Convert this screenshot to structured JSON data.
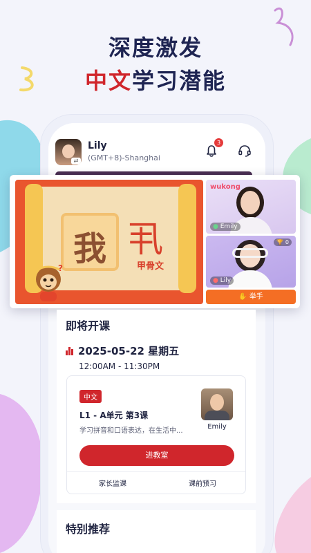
{
  "headline": {
    "line1": "深度激发",
    "line2_highlight": "中文",
    "line2_rest": "学习潜能"
  },
  "colors": {
    "brand_red": "#d0262c",
    "navy": "#1e2452",
    "orange": "#f46e24"
  },
  "profile": {
    "name": "Lily",
    "timezone": "(GMT+8)-Shanghai",
    "avatar_icon": "user-avatar",
    "switch_icon": "swap-icon"
  },
  "header": {
    "notification_icon": "bell-icon",
    "notification_count": "3",
    "support_icon": "headset-icon"
  },
  "classroom": {
    "character": "我",
    "oracle_glyph": "丮",
    "oracle_label": "甲骨文",
    "brand": "wukong",
    "teacher_name": "Emily",
    "student_name": "Lily",
    "trophy_count": "🏆 0",
    "raise_hand": "举手",
    "raise_hand_icon": "hand-icon"
  },
  "upcoming": {
    "title": "即将开课",
    "date": "2025-05-22 星期五",
    "time": "12:00AM - 11:30PM",
    "lesson": {
      "language_tag": "中文",
      "title": "L1 - A单元 第3课",
      "description": "学习拼音和口语表达，在生活中...",
      "teacher": "Emily",
      "enter_button": "进教室",
      "parent_monitor": "家长监课",
      "preview": "课前预习"
    }
  },
  "recommend": {
    "title": "特别推荐"
  }
}
